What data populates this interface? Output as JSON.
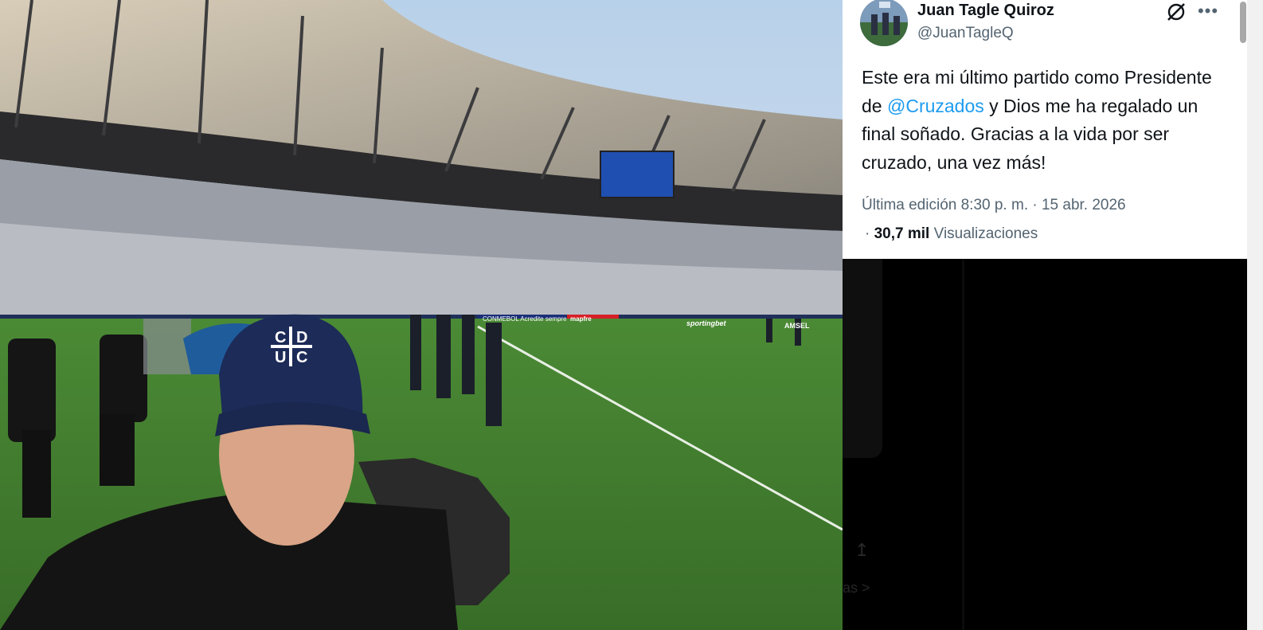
{
  "tweet": {
    "author_name": "Juan Tagle Quiroz",
    "author_handle": "@JuanTagleQ",
    "text_before": "Este era mi último partido como Presidente de ",
    "mention": "@Cruzados",
    "text_after": " y Dios me ha regalado un final soñado. Gracias a la vida por ser cruzado, una vez más!",
    "edited_label": "Última edición 8:30 p. m. · 15 abr. 2026",
    "views_prefix": "·",
    "views_count": "30,7 mil",
    "views_label": "Visualizaciones"
  },
  "photo": {
    "cap_logo": "C|D U|C",
    "banner_left": "CONMEBOL Acredite sempre",
    "banner_mapfre": "mapfre",
    "banner_sportingbet": "sportingbet",
    "banner_amsel": "AMSEL"
  },
  "background": {
    "share_icon": "↥",
    "faded_text": "as >"
  },
  "icons": {
    "grok": "grok-icon",
    "more": "more-icon",
    "share": "share-icon"
  },
  "colors": {
    "mention": "#1d9bf0",
    "secondary_text": "#536471",
    "primary_text": "#0f1419",
    "card_bg": "#ffffff"
  }
}
